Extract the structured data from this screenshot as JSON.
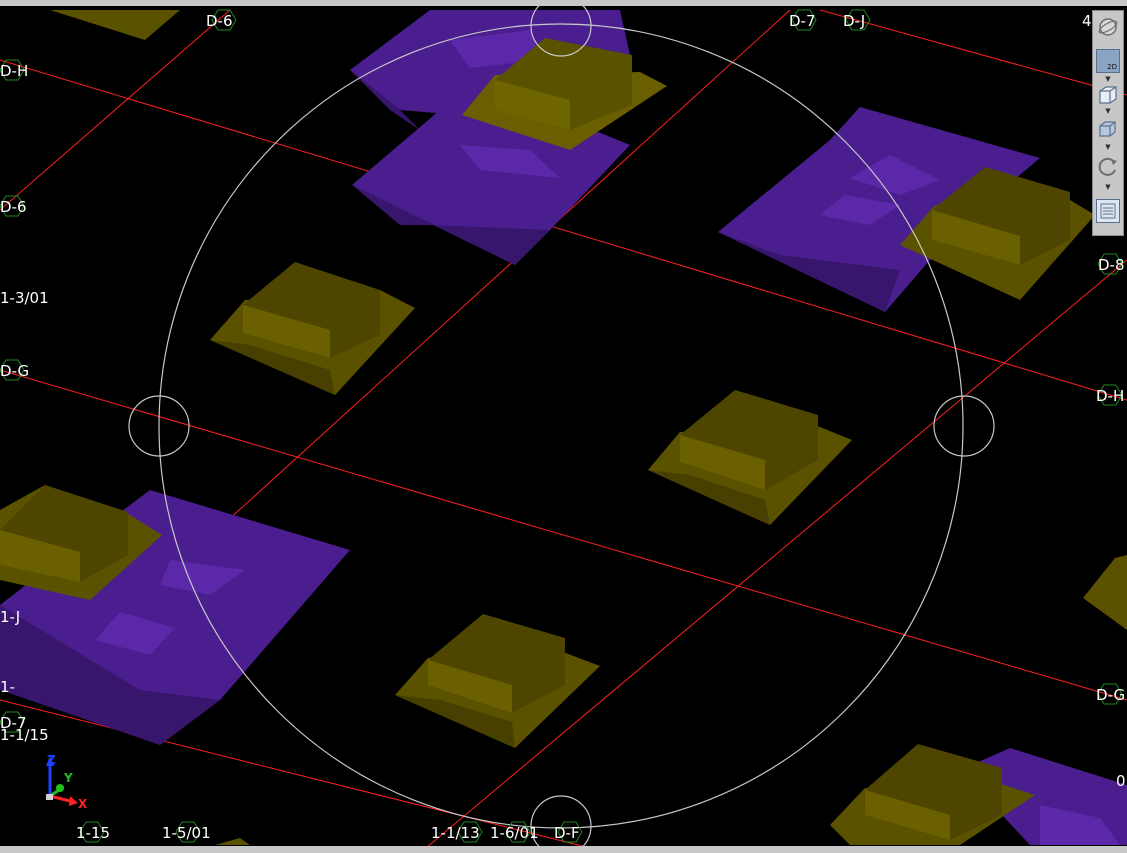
{
  "grid_labels": {
    "top_d6": "D-6",
    "top_d7": "D-7",
    "top_dj": "D-J",
    "top_4": "4",
    "left_dh": "D-H",
    "left_d6": "D-6",
    "left_1_3_01": "1-3/01",
    "left_dg": "D-G",
    "left_1j": "1-J",
    "left_1a": "1-",
    "left_d7": "D-7",
    "left_1_1_15": "1-1/15",
    "right_d8": "D-8",
    "right_dh": "D-H",
    "right_dg": "D-G",
    "right_0": "0",
    "bot_1_15": "1-15",
    "bot_1_5_01": "1-5/01",
    "bot_1_1_13": "1-1/13",
    "bot_1_6_01": "1-6/01",
    "bot_df": "D-F"
  },
  "navigation_bar": {
    "items": [
      {
        "id": "steering-wheel",
        "icon": "steering-wheel-icon"
      },
      {
        "id": "view-2d",
        "icon": "2d-view-icon",
        "label": "2D"
      },
      {
        "id": "view-cube",
        "icon": "view-cube-icon"
      },
      {
        "id": "zoom",
        "icon": "zoom-cube-icon"
      },
      {
        "id": "orbit",
        "icon": "orbit-icon"
      },
      {
        "id": "view-properties",
        "icon": "view-properties-icon"
      }
    ]
  },
  "ucs_icon": {
    "x": "X",
    "y": "Y",
    "z": "Z"
  },
  "colors": {
    "background": "#000000",
    "grid_line": "#ff0000",
    "pile_cap": "#5b5200",
    "footing_purple": "#4a1e8f",
    "orbit_circle": "#c8c8c8",
    "grid_bubble": "#1f8a1f"
  }
}
